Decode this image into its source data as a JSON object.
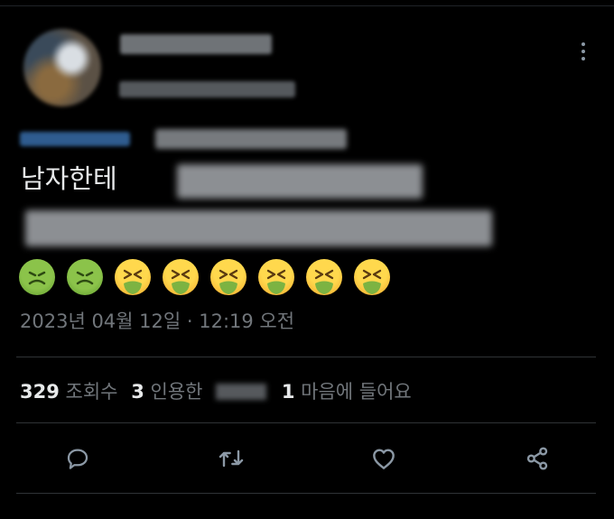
{
  "tweet": {
    "text_line1_prefix": "남자한테",
    "timestamp": "2023년 04월 12일 · 12:19 오전",
    "emoji_icons": [
      "nauseated-face",
      "nauseated-face",
      "face-vomiting",
      "face-vomiting",
      "face-vomiting",
      "face-vomiting",
      "face-vomiting",
      "face-vomiting"
    ]
  },
  "stats": {
    "views_count": "329",
    "views_label": "조회수",
    "quotes_count": "3",
    "quotes_label": "인용한",
    "likes_count": "1",
    "likes_label": "마음에 들어요"
  },
  "actions": {
    "icons": [
      "reply-icon",
      "retweet-icon",
      "like-icon",
      "share-icon"
    ]
  },
  "colors": {
    "background": "#000000",
    "text": "#e7e9ea",
    "secondary": "#71767b",
    "divider": "#2f3336"
  }
}
